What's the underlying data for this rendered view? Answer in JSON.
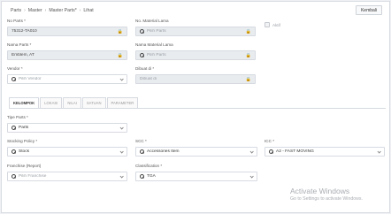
{
  "breadcrumb": [
    "Parts",
    "Master",
    "Master Parts*",
    "Lihat"
  ],
  "back_button": "Kembali",
  "fields": {
    "no_parts": {
      "label": "No Parts *",
      "value": "75312-TA010"
    },
    "no_material_lama": {
      "label": "No. Material Lama",
      "placeholder": "Pilih Parts"
    },
    "aktif": {
      "label": "Aktif"
    },
    "nama_parts": {
      "label": "Nama Parts *",
      "value": "Emblem, AT"
    },
    "nama_material_lama": {
      "label": "Nama Material Lama",
      "placeholder": "Pilih Parts"
    },
    "vendor": {
      "label": "Vendor *",
      "placeholder": "Pilih Vendor"
    },
    "dibuat_di": {
      "label": "Dibuat di *",
      "placeholder": "Dibuat di"
    }
  },
  "tabs": [
    "KELOMPOK",
    "LOKASI",
    "NILAI",
    "SATUAN",
    "PARAMETER"
  ],
  "kelompok": {
    "tipe_parts": {
      "label": "Tipe Parts *",
      "value": "Parts"
    },
    "stocking_policy": {
      "label": "Stocking Policy *",
      "value": "Stock"
    },
    "scc": {
      "label": "SCC *",
      "value": "Accessories Item"
    },
    "icc": {
      "label": "ICC *",
      "value": "A2 - FAST MOVING"
    },
    "franchise": {
      "label": "Franchise (Report)",
      "placeholder": "Pilih Franchise"
    },
    "classification": {
      "label": "Classification *",
      "value": "TGA"
    }
  },
  "watermark": {
    "title": "Activate Windows",
    "subtitle": "Go to Settings to activate Windows."
  }
}
